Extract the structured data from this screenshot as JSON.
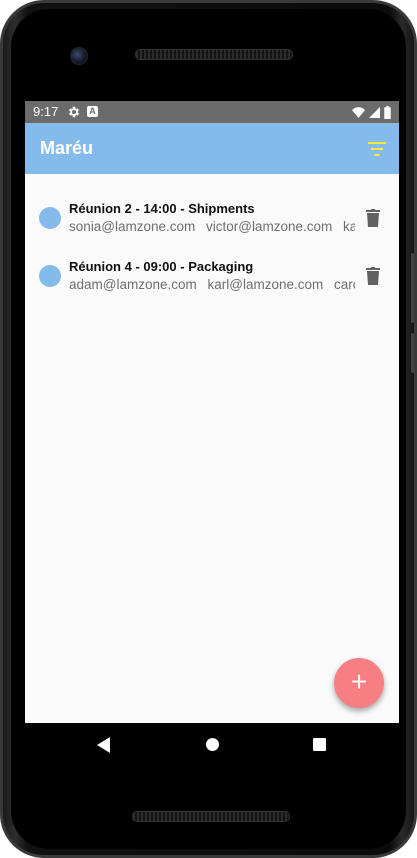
{
  "status_bar": {
    "time": "9:17",
    "a_icon_text": "A",
    "icons": [
      "gear-icon",
      "a-icon",
      "wifi-icon",
      "signal-icon",
      "battery-icon"
    ]
  },
  "app_bar": {
    "title": "Maréu",
    "filter_icon": "filter-icon",
    "filter_color": "#ffeb3b",
    "background": "#85bbea"
  },
  "meetings": [
    {
      "title": "Réunion 2 - 14:00 - Shipments",
      "participants": [
        "sonia@lamzone.com",
        "victor@lamzone.com",
        "karl@lamzone.com"
      ],
      "color": "#85bbea"
    },
    {
      "title": "Réunion 4 - 09:00 - Packaging",
      "participants": [
        "adam@lamzone.com",
        "karl@lamzone.com",
        "carol@lamzone.com"
      ],
      "color": "#85bbea"
    }
  ],
  "fab": {
    "label": "+",
    "color": "#f77f83"
  },
  "nav_bar": {
    "icons": [
      "back-icon",
      "home-icon",
      "recents-icon"
    ]
  }
}
